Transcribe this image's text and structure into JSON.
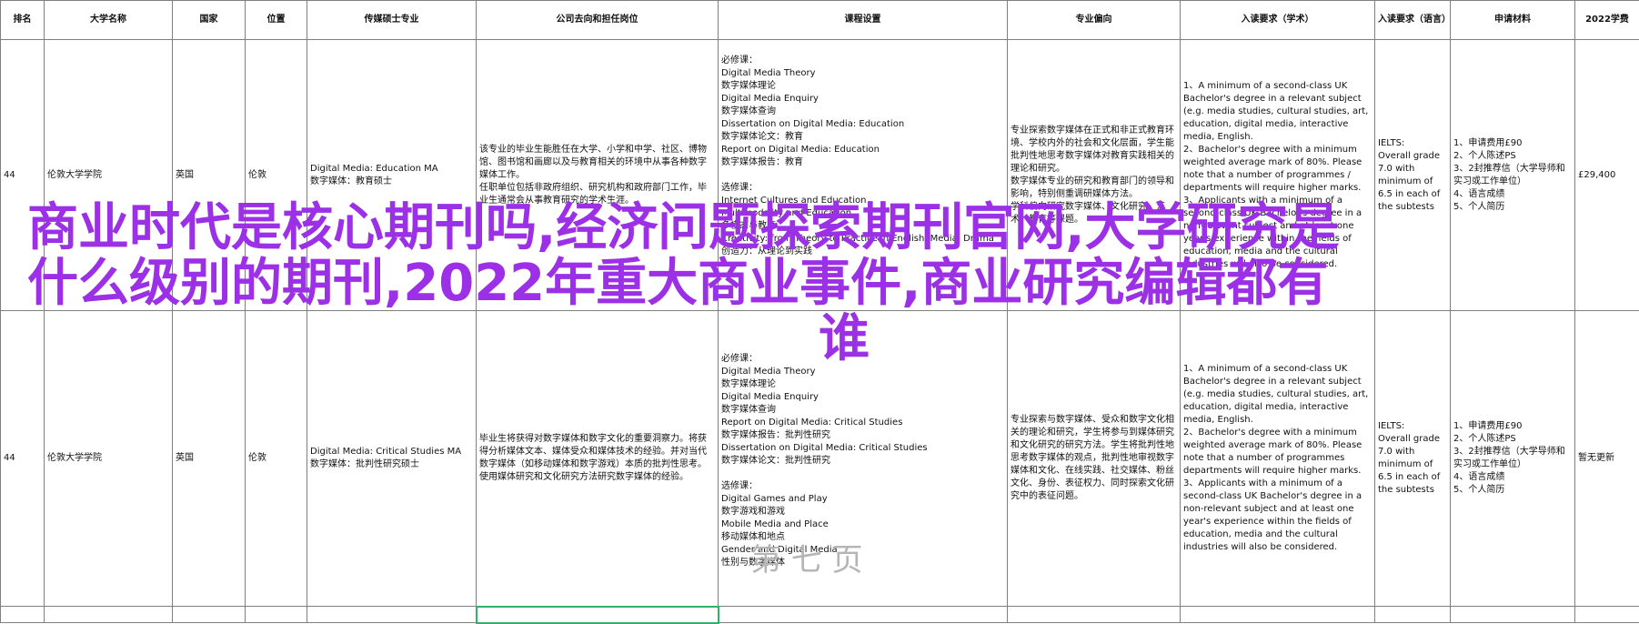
{
  "headers": [
    "排名",
    "大学名称",
    "国家",
    "位置",
    "传媒硕士专业",
    "公司去向和担任岗位",
    "课程设置",
    "专业偏向",
    "入读要求（学术）",
    "入读要求（语言）",
    "申请材料",
    "2022学费"
  ],
  "rows": [
    {
      "rank": "44",
      "university": "伦敦大学学院",
      "country": "英国",
      "location": "伦敦",
      "program": "Digital Media: Education MA\n数字媒体：教育硕士",
      "career": "该专业的毕业生能胜任在大学、小学和中学、社区、博物馆、图书馆和画廊以及与教育相关的环境中从事各种数字媒体工作。\n任职单位包括非政府组织、研究机构和政府部门工作，毕业生通常会从事教育研究的学术生涯。",
      "courses": "必修课：\nDigital Media Theory\n数字媒体理论\nDigital Media Enquiry\n数字媒体查询\nDissertation on Digital Media: Education\n数字媒体论文：教育\nReport on Digital Media: Education\n数字媒体报告：教育\n\n选修课：\nInternet Cultures and Education\nMultimodality and Education\n多模态与教育\nCreativity: from Theory to Practice in English, Media, Drama\n创造力：从理论到实践",
      "focus": "专业探索数字媒体在正式和非正式教育环境、学校内外的社会和文化层面，学生能批判性地思考数字媒体对教育实践相关的理论和研究。\n数字媒体专业的研究和教育部门的领导和影响，特别侧重调研媒体方法。\n学科偏向研究数字媒体、文化研究、艺术、教育等课题。",
      "academic": "1、A minimum of a second-class UK Bachelor's degree in a relevant subject (e.g. media studies, cultural studies, art, education, digital media, interactive media, English.\n2、Bachelor's degree with a minimum weighted average mark of 80%. Please note that a number of programmes / departments will require higher marks.\n3、Applicants with a minimum of a second-class UK Bachelor's degree in a non-relevant subject and at least one year's experience within the fields of education, media and the cultural industries will also be considered.",
      "language": "IELTS:\nOverall grade 7.0 with minimum of 6.5 in each of the subtests",
      "materials": "1、申请费用£90\n2、个人陈述PS\n3、2封推荐信（大学导师和实习或工作单位）\n4、语言成绩\n5、个人简历",
      "tuition": "£29,400"
    },
    {
      "rank": "44",
      "university": "伦敦大学学院",
      "country": "英国",
      "location": "伦敦",
      "program": "Digital Media: Critical Studies MA\n数字媒体：批判性研究硕士",
      "career": "毕业生将获得对数字媒体和数字文化的重要洞察力。将获得分析媒体文本、媒体受众和媒体技术的经验。并对当代数字媒体（如移动媒体和数字游戏）本质的批判性思考。使用媒体研究和文化研究方法研究数字媒体的经验。",
      "courses": "必修课：\nDigital Media Theory\n数字媒体理论\nDigital Media Enquiry\n数字媒体查询\nReport on Digital Media: Critical Studies\n数字媒体报告：批判性研究\nDissertation on Digital Media: Critical Studies\n数字媒体论文：批判性研究\n\n选修课：\nDigital Games and Play\n数字游戏和游戏\nMobile Media and Place\n移动媒体和地点\nGender and Digital Media\n性别与数字媒体",
      "focus": "专业探索与数字媒体、受众和数字文化相关的理论和研究，学生将参与到媒体研究和文化研究的研究方法。学生将批判性地思考数字媒体的观点，批判性地审视数字媒体和文化、在线实践、社交媒体、粉丝文化、身份、表征权力、同时探索文化研究中的表征问题。",
      "academic": "1、A minimum of a second-class UK Bachelor's degree in a relevant subject (e.g. media studies, cultural studies, art, education, digital media, interactive media, English.\n2、Bachelor's degree with a minimum weighted average mark of 80%. Please note that a number of programmes departments will require higher marks.\n3、Applicants with a minimum of a second-class UK Bachelor's degree in a non-relevant subject and at least one year's experience within the fields of education, media and the cultural industries will also be considered.",
      "language": "IELTS:\nOverall grade 7.0 with minimum of 6.5 in each of the subtests",
      "materials": "1、申请费用£90\n2、个人陈述PS\n3、2封推荐信（大学导师和实习或工作单位）\n4、语言成绩\n5、个人简历",
      "tuition": "暂无更新"
    }
  ],
  "overlay": {
    "line1": "商业时代是核心期刊吗,经济问题探索期刊官网,大学研究是",
    "line2": "什么级别的期刊,2022年重大商业事件,商业研究编辑都有",
    "line3": "谁"
  },
  "ghost_text": "第 七 页",
  "colors": {
    "overlay": "#9b30e6",
    "selection": "#2fb36b"
  }
}
